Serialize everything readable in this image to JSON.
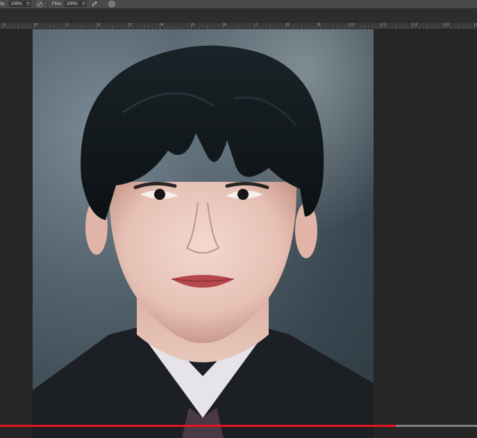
{
  "options_bar": {
    "opacity_label": "ity:",
    "opacity_value": "100%",
    "flow_label": "Flow:",
    "flow_value": "100%",
    "pressure_opacity_icon": "pressure-pen-icon",
    "airbrush_icon": "airbrush-icon",
    "pressure_size_icon": "pressure-size-icon"
  },
  "ruler": {
    "labels": [
      "1",
      "0",
      "1",
      "2",
      "3",
      "4",
      "5",
      "6",
      "7",
      "8",
      "9",
      "10",
      "11",
      "12",
      "13",
      "14"
    ]
  },
  "document": {
    "content": "portrait-photo"
  },
  "video": {
    "progress_fraction": 0.83
  },
  "colors": {
    "ui_background": "#262626",
    "options_bar": "#4a4a4a",
    "progress_played": "#e8141b"
  }
}
